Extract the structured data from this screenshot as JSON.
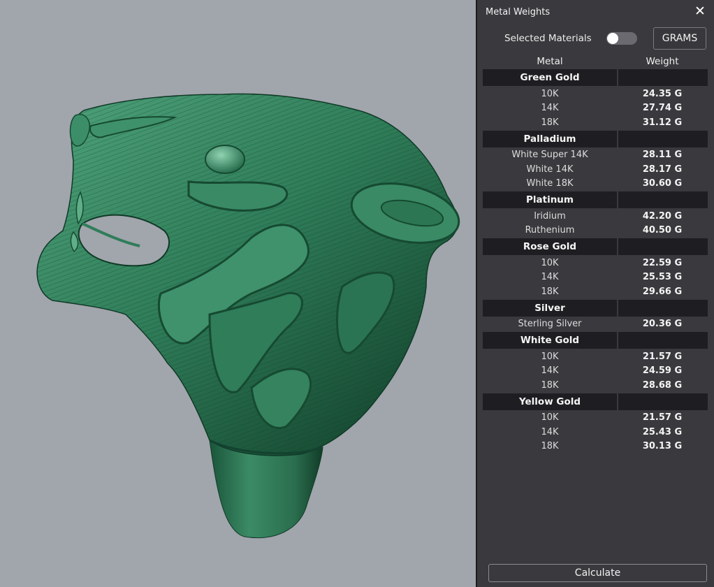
{
  "panel": {
    "title": "Metal Weights",
    "close_icon": "close-icon",
    "selected_materials_label": "Selected Materials",
    "selected_materials_on": false,
    "units_button": "GRAMS",
    "calculate_button": "Calculate"
  },
  "table": {
    "col_metal": "Metal",
    "col_weight": "Weight",
    "groups": [
      {
        "name": "Green Gold",
        "rows": [
          {
            "metal": "10K",
            "weight": "24.35 G"
          },
          {
            "metal": "14K",
            "weight": "27.74 G"
          },
          {
            "metal": "18K",
            "weight": "31.12 G"
          }
        ]
      },
      {
        "name": "Palladium",
        "rows": [
          {
            "metal": "White Super 14K",
            "weight": "28.11 G"
          },
          {
            "metal": "White 14K",
            "weight": "28.17 G"
          },
          {
            "metal": "White 18K",
            "weight": "30.60 G"
          }
        ]
      },
      {
        "name": "Platinum",
        "rows": [
          {
            "metal": "Iridium",
            "weight": "42.20 G"
          },
          {
            "metal": "Ruthenium",
            "weight": "40.50 G"
          }
        ]
      },
      {
        "name": "Rose Gold",
        "rows": [
          {
            "metal": "10K",
            "weight": "22.59 G"
          },
          {
            "metal": "14K",
            "weight": "25.53 G"
          },
          {
            "metal": "18K",
            "weight": "29.66 G"
          }
        ]
      },
      {
        "name": "Silver",
        "rows": [
          {
            "metal": "Sterling Silver",
            "weight": "20.36 G"
          }
        ]
      },
      {
        "name": "White Gold",
        "rows": [
          {
            "metal": "10K",
            "weight": "21.57 G"
          },
          {
            "metal": "14K",
            "weight": "24.59 G"
          },
          {
            "metal": "18K",
            "weight": "28.68 G"
          }
        ]
      },
      {
        "name": "Yellow Gold",
        "rows": [
          {
            "metal": "10K",
            "weight": "21.57 G"
          },
          {
            "metal": "14K",
            "weight": "25.43 G"
          },
          {
            "metal": "18K",
            "weight": "30.13 G"
          }
        ]
      }
    ]
  },
  "viewport": {
    "background_color": "#a1a5ac",
    "model_color": "#2e7a57",
    "model": "tiger-head-ring"
  }
}
